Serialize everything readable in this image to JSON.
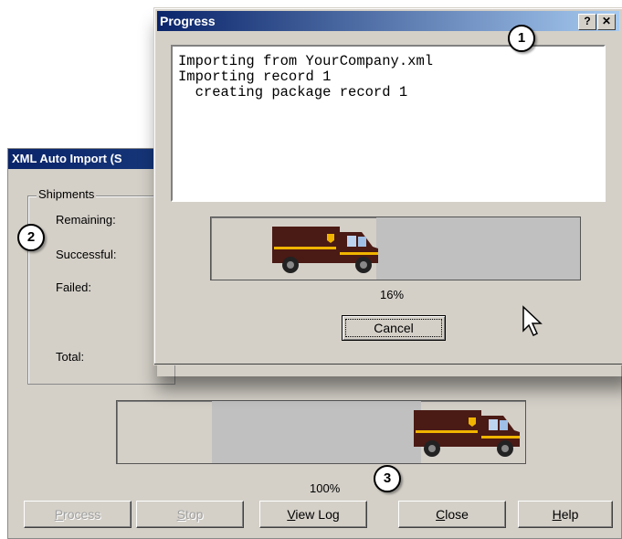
{
  "back_window": {
    "title": "XML Auto Import (S",
    "group_title": "Shipments",
    "stats": [
      "Remaining:",
      "Successful:",
      "Failed:",
      "Total:"
    ],
    "progress_percent_label": "100%",
    "progress_fraction": 1.0,
    "buttons": [
      {
        "pre": "",
        "accel": "P",
        "post": "rocess",
        "enabled": false
      },
      {
        "pre": "",
        "accel": "S",
        "post": "top",
        "enabled": false
      },
      {
        "pre": "",
        "accel": "V",
        "post": "iew Log",
        "enabled": true
      },
      {
        "pre": "",
        "accel": "C",
        "post": "lose",
        "enabled": true
      },
      {
        "pre": "",
        "accel": "H",
        "post": "elp",
        "enabled": true
      }
    ]
  },
  "progress_window": {
    "title": "Progress",
    "help_button": "?",
    "close_button": "✕",
    "log_lines": [
      "Importing from YourCompany.xml",
      "Importing record 1",
      "  creating package record 1"
    ],
    "progress_percent_label": "16%",
    "progress_fraction": 0.16,
    "cancel_label": "Cancel"
  },
  "callouts": [
    "1",
    "2",
    "3"
  ],
  "colors": {
    "truck_body": "#4a1a14",
    "truck_stripe": "#f0b400",
    "titlebar": "#0a246a",
    "dialog_bg": "#d4d0c8"
  }
}
